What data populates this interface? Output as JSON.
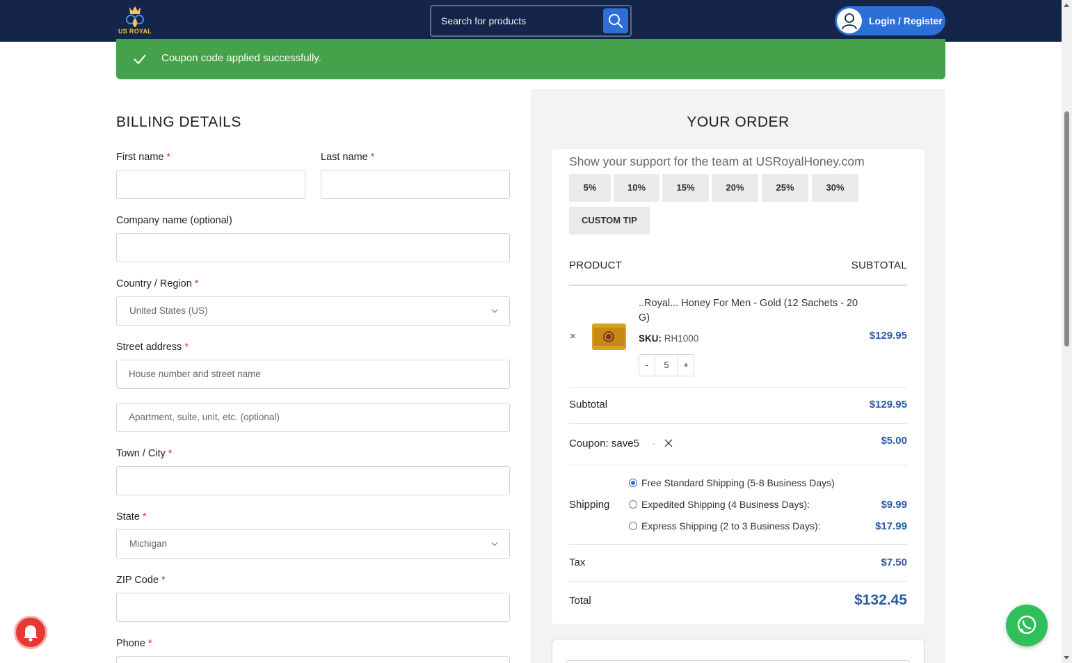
{
  "header": {
    "logo_text": "US ROYAL",
    "search_placeholder": "Search for products",
    "login_label": "Login / Register"
  },
  "notice": {
    "message": "Coupon code applied successfully."
  },
  "billing": {
    "title": "BILLING DETAILS",
    "required_mark": "*",
    "first_name_label": "First name",
    "last_name_label": "Last name",
    "company_label": "Company name (optional)",
    "country_label": "Country / Region",
    "country_value": "United States (US)",
    "street_label": "Street address",
    "street_placeholder": "House number and street name",
    "apartment_placeholder": "Apartment, suite, unit, etc. (optional)",
    "city_label": "Town / City",
    "state_label": "State",
    "state_value": "Michigan",
    "zip_label": "ZIP Code",
    "phone_label": "Phone"
  },
  "order": {
    "title": "YOUR ORDER",
    "tip_heading": "Show your support for the team at USRoyalHoney.com",
    "tips": [
      "5%",
      "10%",
      "15%",
      "20%",
      "25%",
      "30%"
    ],
    "custom_tip": "CUSTOM TIP",
    "col_product": "PRODUCT",
    "col_subtotal": "SUBTOTAL",
    "item": {
      "name": "..Royal... Honey For Men - Gold (12 Sachets - 20 G)",
      "sku_label": "SKU:",
      "sku_value": "RH1000",
      "qty_minus": "-",
      "qty_value": "5",
      "qty_plus": "+",
      "price": "$129.95",
      "remove": "×"
    },
    "subtotal_label": "Subtotal",
    "subtotal_value": "$129.95",
    "coupon_label": "Coupon: save5",
    "coupon_dash": "-",
    "coupon_value": "$5.00",
    "shipping_label": "Shipping",
    "shipping_options": [
      {
        "label": "Free Standard Shipping (5-8 Business Days)",
        "price": ""
      },
      {
        "label": "Expedited Shipping (4 Business Days):",
        "price": "$9.99"
      },
      {
        "label": "Express Shipping (2 to 3 Business Days):",
        "price": "$17.99"
      }
    ],
    "tax_label": "Tax",
    "tax_value": "$7.50",
    "total_label": "Total",
    "total_value": "$132.45"
  },
  "colors": {
    "header_bg": "#14244a",
    "accent": "#2c6fd6",
    "success": "#46a24a",
    "price": "#2a5aa0"
  }
}
